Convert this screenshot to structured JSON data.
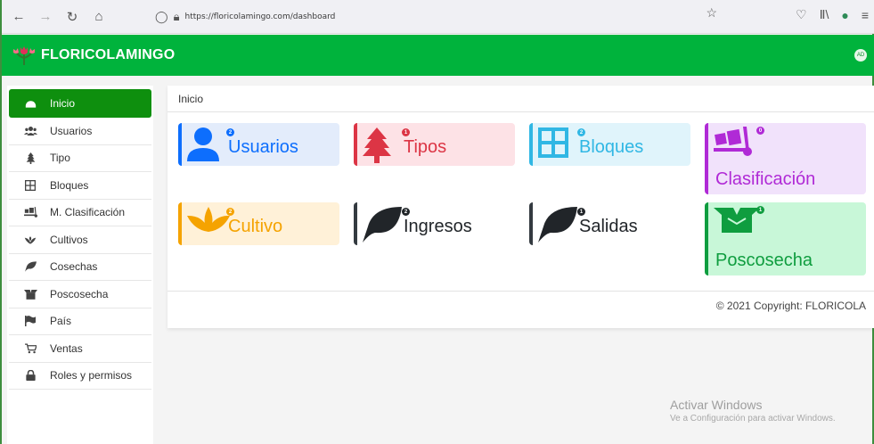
{
  "browser": {
    "url": "https://floricolamingo.com/dashboard",
    "back_icon": "arrow-left-icon",
    "forward_icon": "arrow-right-icon",
    "reload_icon": "reload-icon",
    "home_icon": "home-icon"
  },
  "header": {
    "brand": "FLORICOLAMINGO",
    "avatar": "AD",
    "color": "#00b33c"
  },
  "sidebar": {
    "items": [
      {
        "label": "Inicio",
        "icon": "dashboard-icon",
        "active": true
      },
      {
        "label": "Usuarios",
        "icon": "users-icon"
      },
      {
        "label": "Tipo",
        "icon": "tree-icon"
      },
      {
        "label": "Bloques",
        "icon": "grid-icon"
      },
      {
        "label": "M. Clasificación",
        "icon": "dolly-icon"
      },
      {
        "label": "Cultivos",
        "icon": "seedling-icon"
      },
      {
        "label": "Cosechas",
        "icon": "leaf-icon"
      },
      {
        "label": "Poscosecha",
        "icon": "box-open-icon"
      },
      {
        "label": "País",
        "icon": "flag-icon"
      },
      {
        "label": "Ventas",
        "icon": "cart-icon"
      },
      {
        "label": "Roles y permisos",
        "icon": "lock-icon"
      }
    ]
  },
  "main": {
    "breadcrumb": "Inicio",
    "cards": [
      {
        "label": "Usuarios",
        "count": "2",
        "icon": "user-icon",
        "bg": "#e3ecfb",
        "fg": "#0d6efd",
        "border": "#0d6efd"
      },
      {
        "label": "Tipos",
        "count": "1",
        "icon": "tree-icon",
        "bg": "#fde2e6",
        "fg": "#dc3545",
        "border": "#dc3545"
      },
      {
        "label": "Bloques",
        "count": "2",
        "icon": "grid-icon",
        "bg": "#e0f4fb",
        "fg": "#30b7e4",
        "border": "#30b7e4"
      },
      {
        "label": "Clasificación",
        "count": "0",
        "icon": "dolly-icon",
        "bg": "#f1e2fb",
        "fg": "#b02ad6",
        "border": "#b02ad6"
      },
      {
        "label": "Cultivo",
        "count": "2",
        "icon": "seedling-icon",
        "bg": "#fff1d8",
        "fg": "#f5a300",
        "border": "#f5a300"
      },
      {
        "label": "Ingresos",
        "count": "2",
        "icon": "leaf-icon",
        "bg": "#ffffff",
        "fg": "#212529",
        "border": "#343a40"
      },
      {
        "label": "Salidas",
        "count": "1",
        "icon": "leaf-icon",
        "bg": "#ffffff",
        "fg": "#212529",
        "border": "#343a40"
      },
      {
        "label": "Poscosecha",
        "count": "1",
        "icon": "box-open-icon",
        "bg": "#c8f7d8",
        "fg": "#0f9d3f",
        "border": "#0f9d3f"
      }
    ],
    "copyright": "© 2021 Copyright: FLORICOLA"
  },
  "watermark": {
    "title": "Activar Windows",
    "subtitle": "Ve a Configuración para activar Windows."
  }
}
